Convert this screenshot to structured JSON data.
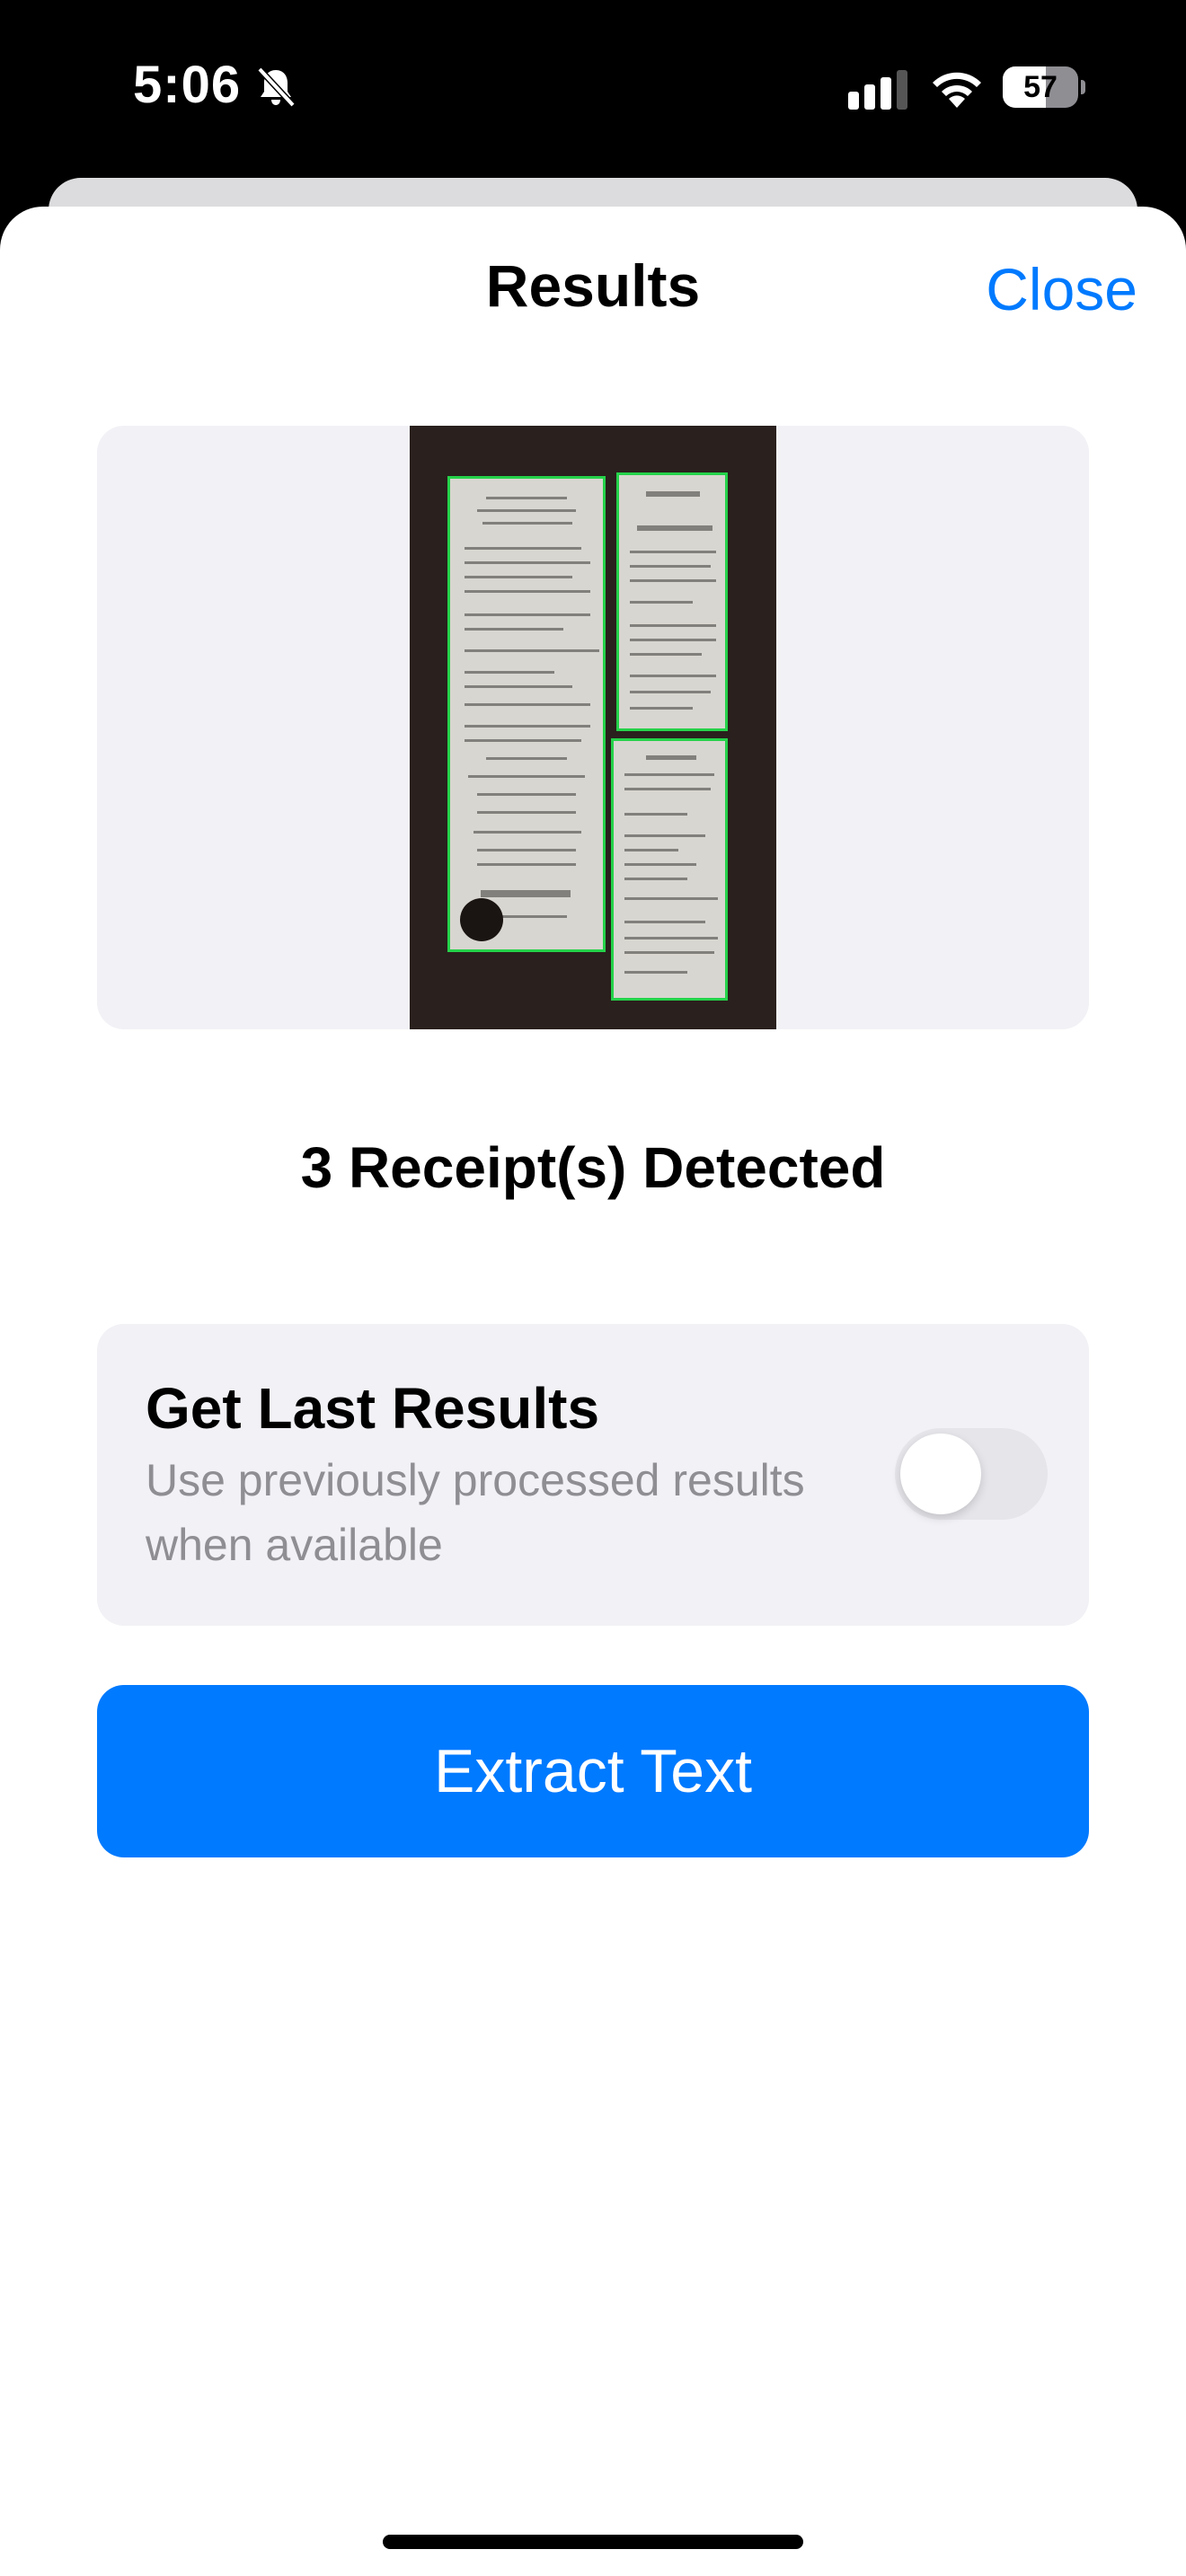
{
  "status_bar": {
    "time": "5:06",
    "battery_level": "57",
    "battery_fraction": 0.57,
    "icons": [
      "bell-slash-icon",
      "cellular-signal-icon",
      "wifi-icon",
      "battery-icon"
    ]
  },
  "header": {
    "title": "Results",
    "close_label": "Close"
  },
  "preview": {
    "image_description_icon": "receipt-scan-image",
    "receipt_count": 3
  },
  "detected": {
    "text": "3 Receipt(s) Detected"
  },
  "get_last_results": {
    "title": "Get Last Results",
    "subtitle": "Use previously processed results when available",
    "enabled": false
  },
  "extract_button": {
    "label": "Extract Text"
  },
  "colors": {
    "accent": "#007aff",
    "card_background": "#f1f1f6",
    "secondary_text": "#8e8e93",
    "detection_outline": "#25d24a"
  }
}
